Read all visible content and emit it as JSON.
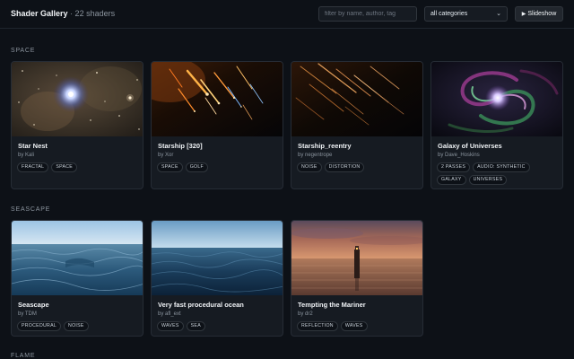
{
  "header": {
    "title": "Shader Gallery",
    "count": "· 22 shaders",
    "search_placeholder": "filter by name, author, tag",
    "category_selected": "all categories",
    "slideshow_label": "Slideshow"
  },
  "sections": [
    {
      "label": "SPACE",
      "cards": [
        {
          "title": "Star Nest",
          "author": "by Kali",
          "tags": [
            "FRACTAL",
            "SPACE"
          ]
        },
        {
          "title": "Starship [320]",
          "author": "by Xor",
          "tags": [
            "SPACE",
            "GOLF"
          ]
        },
        {
          "title": "Starship_reentry",
          "author": "by negentrope",
          "tags": [
            "NOISE",
            "DISTORTION"
          ]
        },
        {
          "title": "Galaxy of Universes",
          "author": "by Dave_Hoskins",
          "tags": [
            "2 PASSES",
            "AUDIO: SYNTHETIC",
            "GALAXY",
            "UNIVERSES"
          ]
        }
      ]
    },
    {
      "label": "SEASCAPE",
      "cards": [
        {
          "title": "Seascape",
          "author": "by TDM",
          "tags": [
            "PROCEDURAL",
            "NOISE"
          ]
        },
        {
          "title": "Very fast procedural ocean",
          "author": "by afl_ext",
          "tags": [
            "WAVES",
            "SEA"
          ]
        },
        {
          "title": "Tempting the Mariner",
          "author": "by dr2",
          "tags": [
            "REFLECTION",
            "WAVES"
          ]
        }
      ]
    },
    {
      "label": "FLAME",
      "cards": []
    }
  ]
}
